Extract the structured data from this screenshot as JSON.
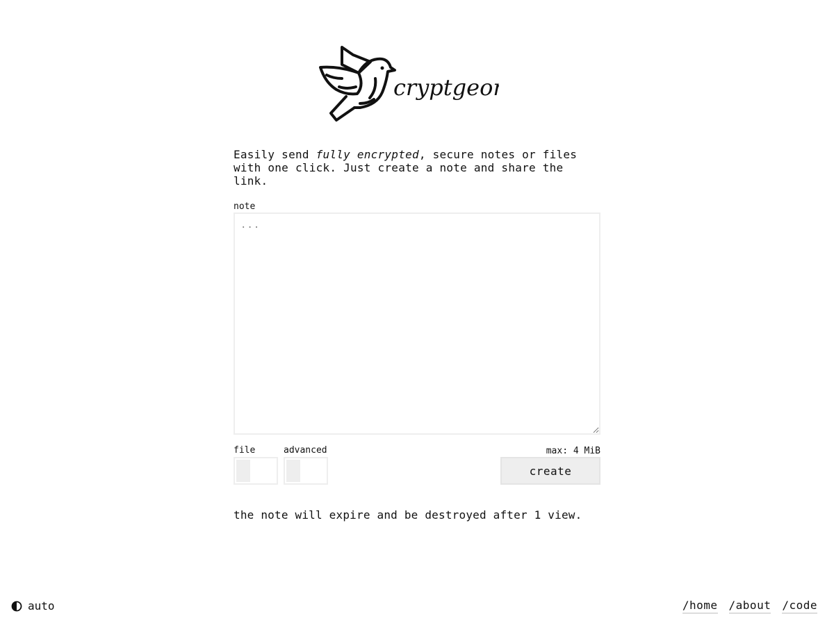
{
  "app": {
    "name": "cryptgeon",
    "logo_icon": "pigeon-icon"
  },
  "intro": {
    "prefix": "Easily send ",
    "emphasis": "fully encrypted",
    "suffix": ", secure notes or files with one click. Just create a note and share the link."
  },
  "form": {
    "note_label": "note",
    "note_value": "",
    "note_placeholder": "...",
    "file_label": "file",
    "file_on": false,
    "advanced_label": "advanced",
    "advanced_on": false,
    "max_size": "max: 4 MiB",
    "create_label": "create"
  },
  "expire_text": "the note will expire and be destroyed after 1 view.",
  "footer": {
    "theme_icon": "half-circle-contrast-icon",
    "theme_label": "auto",
    "links": [
      {
        "label": "/home"
      },
      {
        "label": "/about"
      },
      {
        "label": "/code"
      }
    ]
  },
  "colors": {
    "text": "#111111",
    "border": "#eeeeee",
    "button_bg": "#eeeeee",
    "background": "#ffffff"
  }
}
